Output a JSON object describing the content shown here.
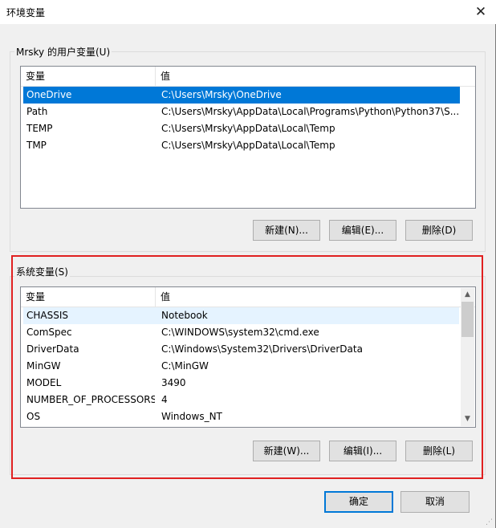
{
  "window": {
    "title": "环境变量",
    "close": "✕"
  },
  "user_vars": {
    "group_label": "Mrsky 的用户变量(U)",
    "col_name": "变量",
    "col_value": "值",
    "rows": [
      {
        "name": "OneDrive",
        "value": "C:\\Users\\Mrsky\\OneDrive"
      },
      {
        "name": "Path",
        "value": "C:\\Users\\Mrsky\\AppData\\Local\\Programs\\Python\\Python37\\S..."
      },
      {
        "name": "TEMP",
        "value": "C:\\Users\\Mrsky\\AppData\\Local\\Temp"
      },
      {
        "name": "TMP",
        "value": "C:\\Users\\Mrsky\\AppData\\Local\\Temp"
      }
    ],
    "selected_row": "OneDrive",
    "buttons": {
      "new": "新建(N)...",
      "edit": "编辑(E)...",
      "delete": "删除(D)"
    }
  },
  "system_vars": {
    "group_label": "系统变量(S)",
    "col_name": "变量",
    "col_value": "值",
    "rows": [
      {
        "name": "CHASSIS",
        "value": "Notebook"
      },
      {
        "name": "ComSpec",
        "value": "C:\\WINDOWS\\system32\\cmd.exe"
      },
      {
        "name": "DriverData",
        "value": "C:\\Windows\\System32\\Drivers\\DriverData"
      },
      {
        "name": "MinGW",
        "value": "C:\\MinGW"
      },
      {
        "name": "MODEL",
        "value": "3490"
      },
      {
        "name": "NUMBER_OF_PROCESSORS",
        "value": "4"
      },
      {
        "name": "OS",
        "value": "Windows_NT"
      }
    ],
    "hot_row": "CHASSIS",
    "buttons": {
      "new": "新建(W)...",
      "edit": "编辑(I)...",
      "delete": "删除(L)"
    },
    "scroll_icons": {
      "up": "▲",
      "down": "▼"
    }
  },
  "footer": {
    "ok": "确定",
    "cancel": "取消"
  },
  "colors": {
    "selection": "#0078d7",
    "highlight_box": "#e02020",
    "hover_row": "#e5f3ff"
  }
}
